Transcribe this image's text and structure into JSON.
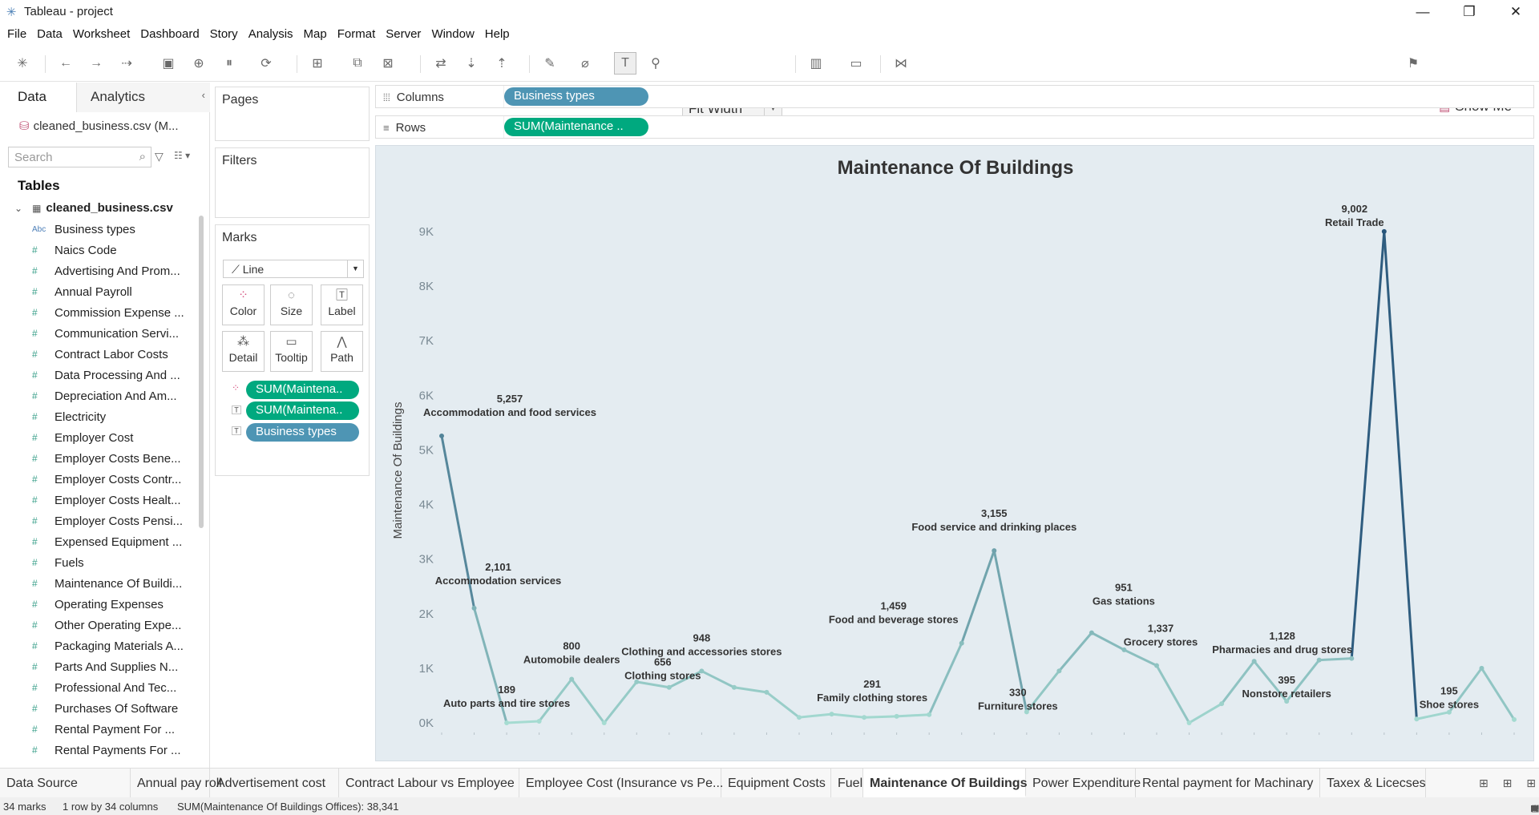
{
  "app": {
    "window_title": "Tableau - project"
  },
  "menu": [
    "File",
    "Data",
    "Worksheet",
    "Dashboard",
    "Story",
    "Analysis",
    "Map",
    "Format",
    "Server",
    "Window",
    "Help"
  ],
  "toolbar": {
    "fit": "Fit Width",
    "show_me": "Show Me"
  },
  "data_pane": {
    "tab_data": "Data",
    "tab_analytics": "Analytics",
    "datasource": "cleaned_business.csv (M...",
    "search_placeholder": "Search",
    "tables_heading": "Tables",
    "table_name": "cleaned_business.csv",
    "fields": [
      {
        "type": "Abc",
        "name": "Business types"
      },
      {
        "type": "#",
        "name": "Naics Code"
      },
      {
        "type": "#",
        "name": "Advertising And Prom..."
      },
      {
        "type": "#",
        "name": "Annual Payroll"
      },
      {
        "type": "#",
        "name": "Commission Expense ..."
      },
      {
        "type": "#",
        "name": "Communication Servi..."
      },
      {
        "type": "#",
        "name": "Contract Labor Costs"
      },
      {
        "type": "#",
        "name": "Data Processing And ..."
      },
      {
        "type": "#",
        "name": "Depreciation And Am..."
      },
      {
        "type": "#",
        "name": "Electricity"
      },
      {
        "type": "#",
        "name": "Employer Cost"
      },
      {
        "type": "#",
        "name": "Employer Costs Bene..."
      },
      {
        "type": "#",
        "name": "Employer Costs Contr..."
      },
      {
        "type": "#",
        "name": "Employer Costs Healt..."
      },
      {
        "type": "#",
        "name": "Employer Costs Pensi..."
      },
      {
        "type": "#",
        "name": "Expensed Equipment ..."
      },
      {
        "type": "#",
        "name": "Fuels"
      },
      {
        "type": "#",
        "name": "Maintenance Of Buildi..."
      },
      {
        "type": "#",
        "name": "Operating Expenses"
      },
      {
        "type": "#",
        "name": "Other Operating Expe..."
      },
      {
        "type": "#",
        "name": "Packaging Materials A..."
      },
      {
        "type": "#",
        "name": "Parts And Supplies N..."
      },
      {
        "type": "#",
        "name": "Professional And Tec..."
      },
      {
        "type": "#",
        "name": "Purchases Of Software"
      },
      {
        "type": "#",
        "name": "Rental Payment For ..."
      },
      {
        "type": "#",
        "name": "Rental Payments For ..."
      }
    ]
  },
  "cards": {
    "pages": "Pages",
    "filters": "Filters",
    "marks": "Marks",
    "mark_type": "Line",
    "buttons": {
      "color": "Color",
      "size": "Size",
      "label": "Label",
      "detail": "Detail",
      "tooltip": "Tooltip",
      "path": "Path"
    },
    "mark_pills": [
      "SUM(Maintena..",
      "SUM(Maintena..",
      "Business types"
    ]
  },
  "shelves": {
    "columns_label": "Columns",
    "columns_pill": "Business types",
    "rows_label": "Rows",
    "rows_pill": "SUM(Maintenance .."
  },
  "chart_data": {
    "type": "line",
    "title": "Maintenance Of Buildings",
    "ylabel": "Maintenance Of Buildings",
    "ylim": [
      0,
      9000
    ],
    "yticks": [
      "0K",
      "1K",
      "2K",
      "3K",
      "4K",
      "5K",
      "6K",
      "7K",
      "8K",
      "9K"
    ],
    "values": [
      5257,
      2101,
      0,
      30,
      800,
      0,
      750,
      650,
      948,
      650,
      560,
      100,
      160,
      100,
      120,
      150,
      1459,
      3155,
      200,
      951,
      1650,
      1337,
      1050,
      0,
      350,
      1128,
      395,
      1150,
      1180,
      9002,
      70,
      195,
      1000,
      60
    ],
    "labels": [
      {
        "i": 0,
        "value": "5,257",
        "name": "Accommodation and food services"
      },
      {
        "i": 1,
        "value": "2,101",
        "name": "Accommodation services"
      },
      {
        "i": 2,
        "value": "189",
        "name": "Auto parts and tire stores"
      },
      {
        "i": 4,
        "value": "800",
        "name": "Automobile dealers"
      },
      {
        "i": 7,
        "value": "656",
        "name": "Clothing stores"
      },
      {
        "i": 8,
        "value": "948",
        "name": "Clothing and accessories stores"
      },
      {
        "i": 13,
        "value": "291",
        "name": "Family clothing stores"
      },
      {
        "i": 16,
        "value": "1,459",
        "name": "Food and beverage stores"
      },
      {
        "i": 17,
        "value": "3,155",
        "name": "Food service and drinking places"
      },
      {
        "i": 18,
        "value": "330",
        "name": "Furniture stores"
      },
      {
        "i": 20,
        "value": "951",
        "name": "Gas stations"
      },
      {
        "i": 22,
        "value": "1,337",
        "name": "Grocery stores"
      },
      {
        "i": 26,
        "value": "395",
        "name": "Nonstore retailers"
      },
      {
        "i": 25,
        "value": "1,128",
        "name": "Pharmacies and drug stores"
      },
      {
        "i": 29,
        "value": "9,002",
        "name": "Retail Trade"
      },
      {
        "i": 31,
        "value": "195",
        "name": "Shoe stores"
      }
    ],
    "color_low": "#a6dcd2",
    "color_high": "#27557a",
    "grid": false
  },
  "sheet_tabs": [
    "Data Source",
    "Annual pay roll",
    "Advertisement cost",
    "Contract Labour vs Employee",
    "Employee Cost (Insurance vs Pe...",
    "Equipment Costs",
    "Fuel",
    "Maintenance Of Buildings",
    "Power Expenditure",
    "Rental payment for Machinary",
    "Taxex & Licecses"
  ],
  "active_tab": "Maintenance Of Buildings",
  "status": {
    "marks": "34 marks",
    "dims": "1 row by 34 columns",
    "sum": "SUM(Maintenance Of Buildings Offices): 38,341"
  }
}
